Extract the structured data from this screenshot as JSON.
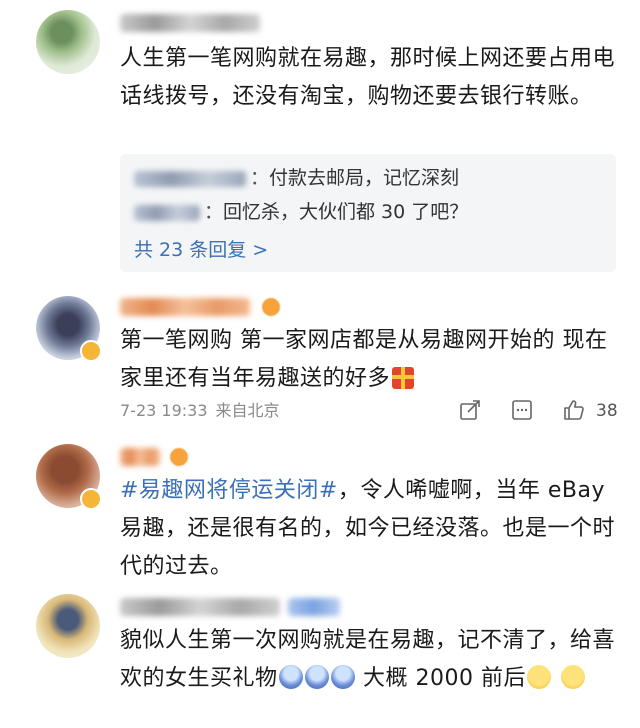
{
  "comments": [
    {
      "text": "人生第一笔网购就在易趣，那时候上网还要占用电话线拨号，还没有淘宝，购物还要去银行转账。",
      "replies": [
        {
          "sep": "：",
          "text": "付款去邮局，记忆深刻"
        },
        {
          "sep": "：",
          "text": "回忆杀，大伙们都 30 了吧？"
        }
      ],
      "more_replies": "共 23 条回复 >"
    },
    {
      "text": "第一笔网购 第一家网店都是从易趣网开始的 现在家里还有当年易趣送的好多",
      "trailing_icon": "gift-icon",
      "timestamp": "7-23 19:33",
      "location": "来自北京",
      "like_count": "38"
    },
    {
      "hashtag": "#易趣网将停运关闭#",
      "text": "，令人唏嘘啊，当年 eBay 易趣，还是很有名的，如今已经没落。也是一个时代的过去。"
    },
    {
      "text_a": "貌似人生第一次网购就是在易趣，记不清了，给喜欢的女生买礼物",
      "text_b": "大概 2000 前后",
      "emojis": [
        "scream-emoji",
        "scream-emoji",
        "scream-emoji",
        "laugh-cry-emoji",
        "laugh-cry-emoji"
      ]
    }
  ],
  "colors": {
    "link": "#3b6fb6",
    "meta_text": "#8a8a8a",
    "reply_bg": "#f4f5f7"
  }
}
